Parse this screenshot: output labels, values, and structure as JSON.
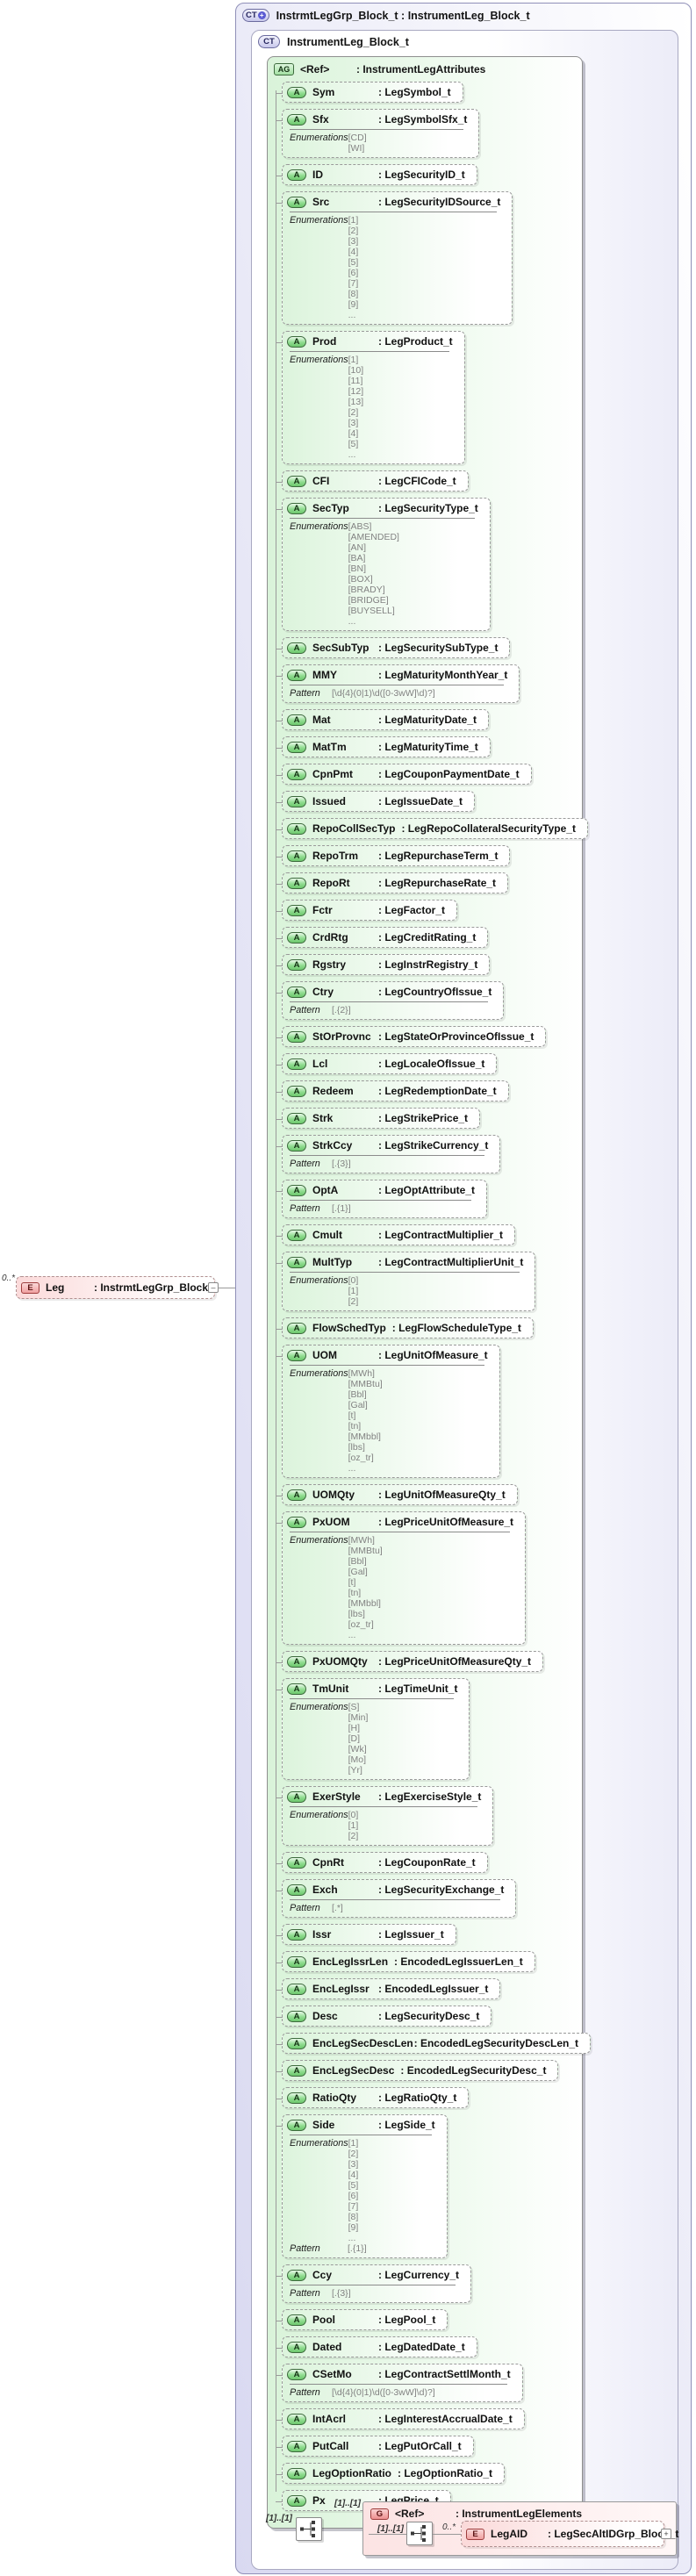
{
  "diagram": {
    "outer": {
      "badge": "CT",
      "badge_plus": "+",
      "title": "InstrmtLegGrp_Block_t : InstrumentLeg_Block_t"
    },
    "ct": {
      "badge": "CT",
      "title": "InstrumentLeg_Block_t"
    },
    "ag": {
      "badge": "AG",
      "name": "<Ref>",
      "type": ": InstrumentLegAttributes"
    },
    "attr_badge": "A",
    "enum_label": "Enumerations",
    "pattern_label": "Pattern",
    "more": "...",
    "attributes": [
      {
        "name": "Sym",
        "type": ": LegSymbol_t"
      },
      {
        "name": "Sfx",
        "type": ": LegSymbolSfx_t",
        "enums": [
          "[CD]",
          "[WI]"
        ]
      },
      {
        "name": "ID",
        "type": ": LegSecurityID_t"
      },
      {
        "name": "Src",
        "type": ": LegSecurityIDSource_t",
        "enums": [
          "[1]",
          "[2]",
          "[3]",
          "[4]",
          "[5]",
          "[6]",
          "[7]",
          "[8]",
          "[9]"
        ],
        "more": true
      },
      {
        "name": "Prod",
        "type": ": LegProduct_t",
        "enums": [
          "[1]",
          "[10]",
          "[11]",
          "[12]",
          "[13]",
          "[2]",
          "[3]",
          "[4]",
          "[5]"
        ],
        "more": true
      },
      {
        "name": "CFI",
        "type": ": LegCFICode_t"
      },
      {
        "name": "SecTyp",
        "type": ": LegSecurityType_t",
        "enums": [
          "[ABS]",
          "[AMENDED]",
          "[AN]",
          "[BA]",
          "[BN]",
          "[BOX]",
          "[BRADY]",
          "[BRIDGE]",
          "[BUYSELL]"
        ],
        "more": true
      },
      {
        "name": "SecSubTyp",
        "type": ": LegSecuritySubType_t"
      },
      {
        "name": "MMY",
        "type": ": LegMaturityMonthYear_t",
        "pattern": "[\\d{4}(0|1)\\d([0-3wW]\\d)?]"
      },
      {
        "name": "Mat",
        "type": ": LegMaturityDate_t"
      },
      {
        "name": "MatTm",
        "type": ": LegMaturityTime_t"
      },
      {
        "name": "CpnPmt",
        "type": ": LegCouponPaymentDate_t"
      },
      {
        "name": "Issued",
        "type": ": LegIssueDate_t"
      },
      {
        "name": "RepoCollSecTyp",
        "type": ": LegRepoCollateralSecurityType_t"
      },
      {
        "name": "RepoTrm",
        "type": ": LegRepurchaseTerm_t"
      },
      {
        "name": "RepoRt",
        "type": ": LegRepurchaseRate_t"
      },
      {
        "name": "Fctr",
        "type": ": LegFactor_t"
      },
      {
        "name": "CrdRtg",
        "type": ": LegCreditRating_t"
      },
      {
        "name": "Rgstry",
        "type": ": LegInstrRegistry_t"
      },
      {
        "name": "Ctry",
        "type": ": LegCountryOfIssue_t",
        "pattern": "[.{2}]"
      },
      {
        "name": "StOrProvnc",
        "type": ": LegStateOrProvinceOfIssue_t"
      },
      {
        "name": "Lcl",
        "type": ": LegLocaleOfIssue_t"
      },
      {
        "name": "Redeem",
        "type": ": LegRedemptionDate_t"
      },
      {
        "name": "Strk",
        "type": ": LegStrikePrice_t"
      },
      {
        "name": "StrkCcy",
        "type": ": LegStrikeCurrency_t",
        "pattern": "[.{3}]"
      },
      {
        "name": "OptA",
        "type": ": LegOptAttribute_t",
        "pattern": "[.{1}]"
      },
      {
        "name": "Cmult",
        "type": ": LegContractMultiplier_t"
      },
      {
        "name": "MultTyp",
        "type": ": LegContractMultiplierUnit_t",
        "enums": [
          "[0]",
          "[1]",
          "[2]"
        ]
      },
      {
        "name": "FlowSchedTyp",
        "type": ": LegFlowScheduleType_t"
      },
      {
        "name": "UOM",
        "type": ": LegUnitOfMeasure_t",
        "enums": [
          "[MWh]",
          "[MMBtu]",
          "[Bbl]",
          "[Gal]",
          "[t]",
          "[tn]",
          "[MMbbl]",
          "[lbs]",
          "[oz_tr]"
        ],
        "more": true
      },
      {
        "name": "UOMQty",
        "type": ": LegUnitOfMeasureQty_t"
      },
      {
        "name": "PxUOM",
        "type": ": LegPriceUnitOfMeasure_t",
        "enums": [
          "[MWh]",
          "[MMBtu]",
          "[Bbl]",
          "[Gal]",
          "[t]",
          "[tn]",
          "[MMbbl]",
          "[lbs]",
          "[oz_tr]"
        ],
        "more": true
      },
      {
        "name": "PxUOMQty",
        "type": ": LegPriceUnitOfMeasureQty_t"
      },
      {
        "name": "TmUnit",
        "type": ": LegTimeUnit_t",
        "enums": [
          "[S]",
          "[Min]",
          "[H]",
          "[D]",
          "[Wk]",
          "[Mo]",
          "[Yr]"
        ]
      },
      {
        "name": "ExerStyle",
        "type": ": LegExerciseStyle_t",
        "enums": [
          "[0]",
          "[1]",
          "[2]"
        ]
      },
      {
        "name": "CpnRt",
        "type": ": LegCouponRate_t"
      },
      {
        "name": "Exch",
        "type": ": LegSecurityExchange_t",
        "pattern": "[.*]"
      },
      {
        "name": "Issr",
        "type": ": LegIssuer_t"
      },
      {
        "name": "EncLegIssrLen",
        "type": ": EncodedLegIssuerLen_t"
      },
      {
        "name": "EncLegIssr",
        "type": ": EncodedLegIssuer_t"
      },
      {
        "name": "Desc",
        "type": ": LegSecurityDesc_t"
      },
      {
        "name": "EncLegSecDescLen",
        "type": ": EncodedLegSecurityDescLen_t"
      },
      {
        "name": "EncLegSecDesc",
        "type": ": EncodedLegSecurityDesc_t"
      },
      {
        "name": "RatioQty",
        "type": ": LegRatioQty_t"
      },
      {
        "name": "Side",
        "type": ": LegSide_t",
        "enums": [
          "[1]",
          "[2]",
          "[3]",
          "[4]",
          "[5]",
          "[6]",
          "[7]",
          "[8]",
          "[9]"
        ],
        "more": true,
        "pattern": "[.{1}]"
      },
      {
        "name": "Ccy",
        "type": ": LegCurrency_t",
        "pattern": "[.{3}]"
      },
      {
        "name": "Pool",
        "type": ": LegPool_t"
      },
      {
        "name": "Dated",
        "type": ": LegDatedDate_t"
      },
      {
        "name": "CSetMo",
        "type": ": LegContractSettlMonth_t",
        "pattern": "[\\d{4}(0|1)\\d([0-3wW]\\d)?]"
      },
      {
        "name": "IntAcrl",
        "type": ": LegInterestAccrualDate_t"
      },
      {
        "name": "PutCall",
        "type": ": LegPutOrCall_t"
      },
      {
        "name": "LegOptionRatio",
        "type": ": LegOptionRatio_t"
      },
      {
        "name": "Px",
        "type": ": LegPrice_t"
      }
    ],
    "leg": {
      "badge": "E",
      "name": "Leg",
      "type": ": InstrmtLegGrp_Block_t",
      "occurrence": "0..*",
      "handle": "–"
    },
    "group": {
      "occ_trunk": "[1]..[1]",
      "occ_group": "[1]..[1]",
      "badge": "G",
      "name": "<Ref>",
      "type": ": InstrumentLegElements",
      "occ_seq": "[1]..[1]",
      "occ_elem": "0..*",
      "element": {
        "badge": "E",
        "name": "LegAID",
        "type": ": LegSecAltIDGrp_Block_t",
        "expand": "+"
      }
    },
    "colors": {
      "accent_green": "#8fdc8f",
      "accent_lavender": "#d9d9f1",
      "accent_pink": "#f0a0a0",
      "line": "#9a9a9a"
    }
  }
}
